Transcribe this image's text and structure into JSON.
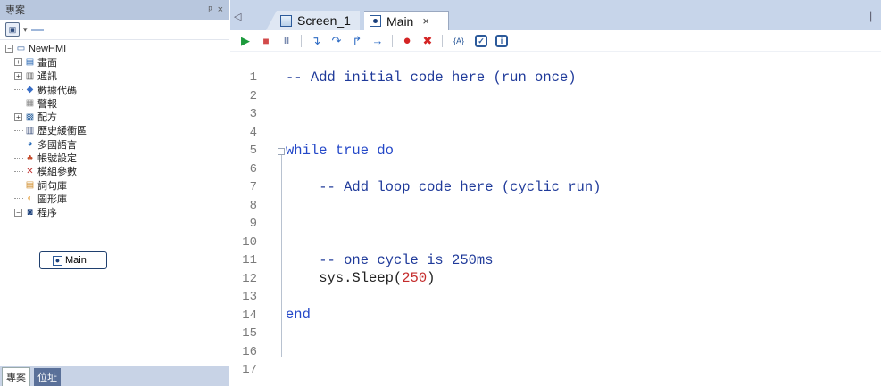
{
  "left_panel": {
    "title": "專案",
    "header_buttons": [
      "ᵖ",
      "×"
    ],
    "tree": [
      {
        "label": "NewHMI",
        "level": 0,
        "expander": "−",
        "icon": "project-icon"
      },
      {
        "label": "畫面",
        "level": 1,
        "expander": "+",
        "icon": "screen-icon"
      },
      {
        "label": "通訊",
        "level": 1,
        "expander": "+",
        "icon": "comm-icon"
      },
      {
        "label": "數據代碼",
        "level": 1,
        "expander": "",
        "icon": "tag-icon"
      },
      {
        "label": "警報",
        "level": 1,
        "expander": "",
        "icon": "alarm-icon"
      },
      {
        "label": "配方",
        "level": 1,
        "expander": "+",
        "icon": "recipe-icon"
      },
      {
        "label": "歷史緩衝區",
        "level": 1,
        "expander": "",
        "icon": "history-icon"
      },
      {
        "label": "多國語言",
        "level": 1,
        "expander": "",
        "icon": "language-icon"
      },
      {
        "label": "帳號設定",
        "level": 1,
        "expander": "",
        "icon": "account-icon"
      },
      {
        "label": "模組參數",
        "level": 1,
        "expander": "",
        "icon": "module-icon"
      },
      {
        "label": "詞句庫",
        "level": 1,
        "expander": "",
        "icon": "text-library-icon"
      },
      {
        "label": "圖形庫",
        "level": 1,
        "expander": "",
        "icon": "graphic-library-icon"
      },
      {
        "label": "程序",
        "level": 1,
        "expander": "−",
        "icon": "program-icon"
      }
    ],
    "selected_item": "Main",
    "bottom_tabs": [
      "專案",
      "位址"
    ]
  },
  "tabs": [
    {
      "label": "Screen_1",
      "icon": "screen-icon",
      "active": false
    },
    {
      "label": "Main",
      "icon": "script-icon",
      "active": true,
      "close": "×"
    }
  ],
  "toolbar_icons": [
    "run-icon",
    "stop-icon",
    "pause-icon",
    "step-into-icon",
    "step-over-icon",
    "step-out-icon",
    "run-to-cursor-icon",
    "breakpoint-icon",
    "clear-breakpoints-icon",
    "variable-icon",
    "check-syntax-icon",
    "info-icon"
  ],
  "editor": {
    "line_numbers": [
      "1",
      "2",
      "3",
      "4",
      "5",
      "6",
      "7",
      "8",
      "9",
      "10",
      "11",
      "12",
      "13",
      "14",
      "15",
      "16",
      "17"
    ],
    "code": {
      "l1": "-- Add initial code here (run once)",
      "l5_kw": "while true do",
      "l7": "    -- Add loop code here (cyclic run)",
      "l11": "    -- one cycle is 250ms",
      "l12_a": "    sys.Sleep(",
      "l12_num": "250",
      "l12_b": ")",
      "l14": "end"
    }
  },
  "colors": {
    "comment": "#1f3a9a",
    "keyword": "#2448c8",
    "number": "#c42b2b",
    "tabbar": "#c7d5ea",
    "panel_header": "#b8c7de"
  }
}
